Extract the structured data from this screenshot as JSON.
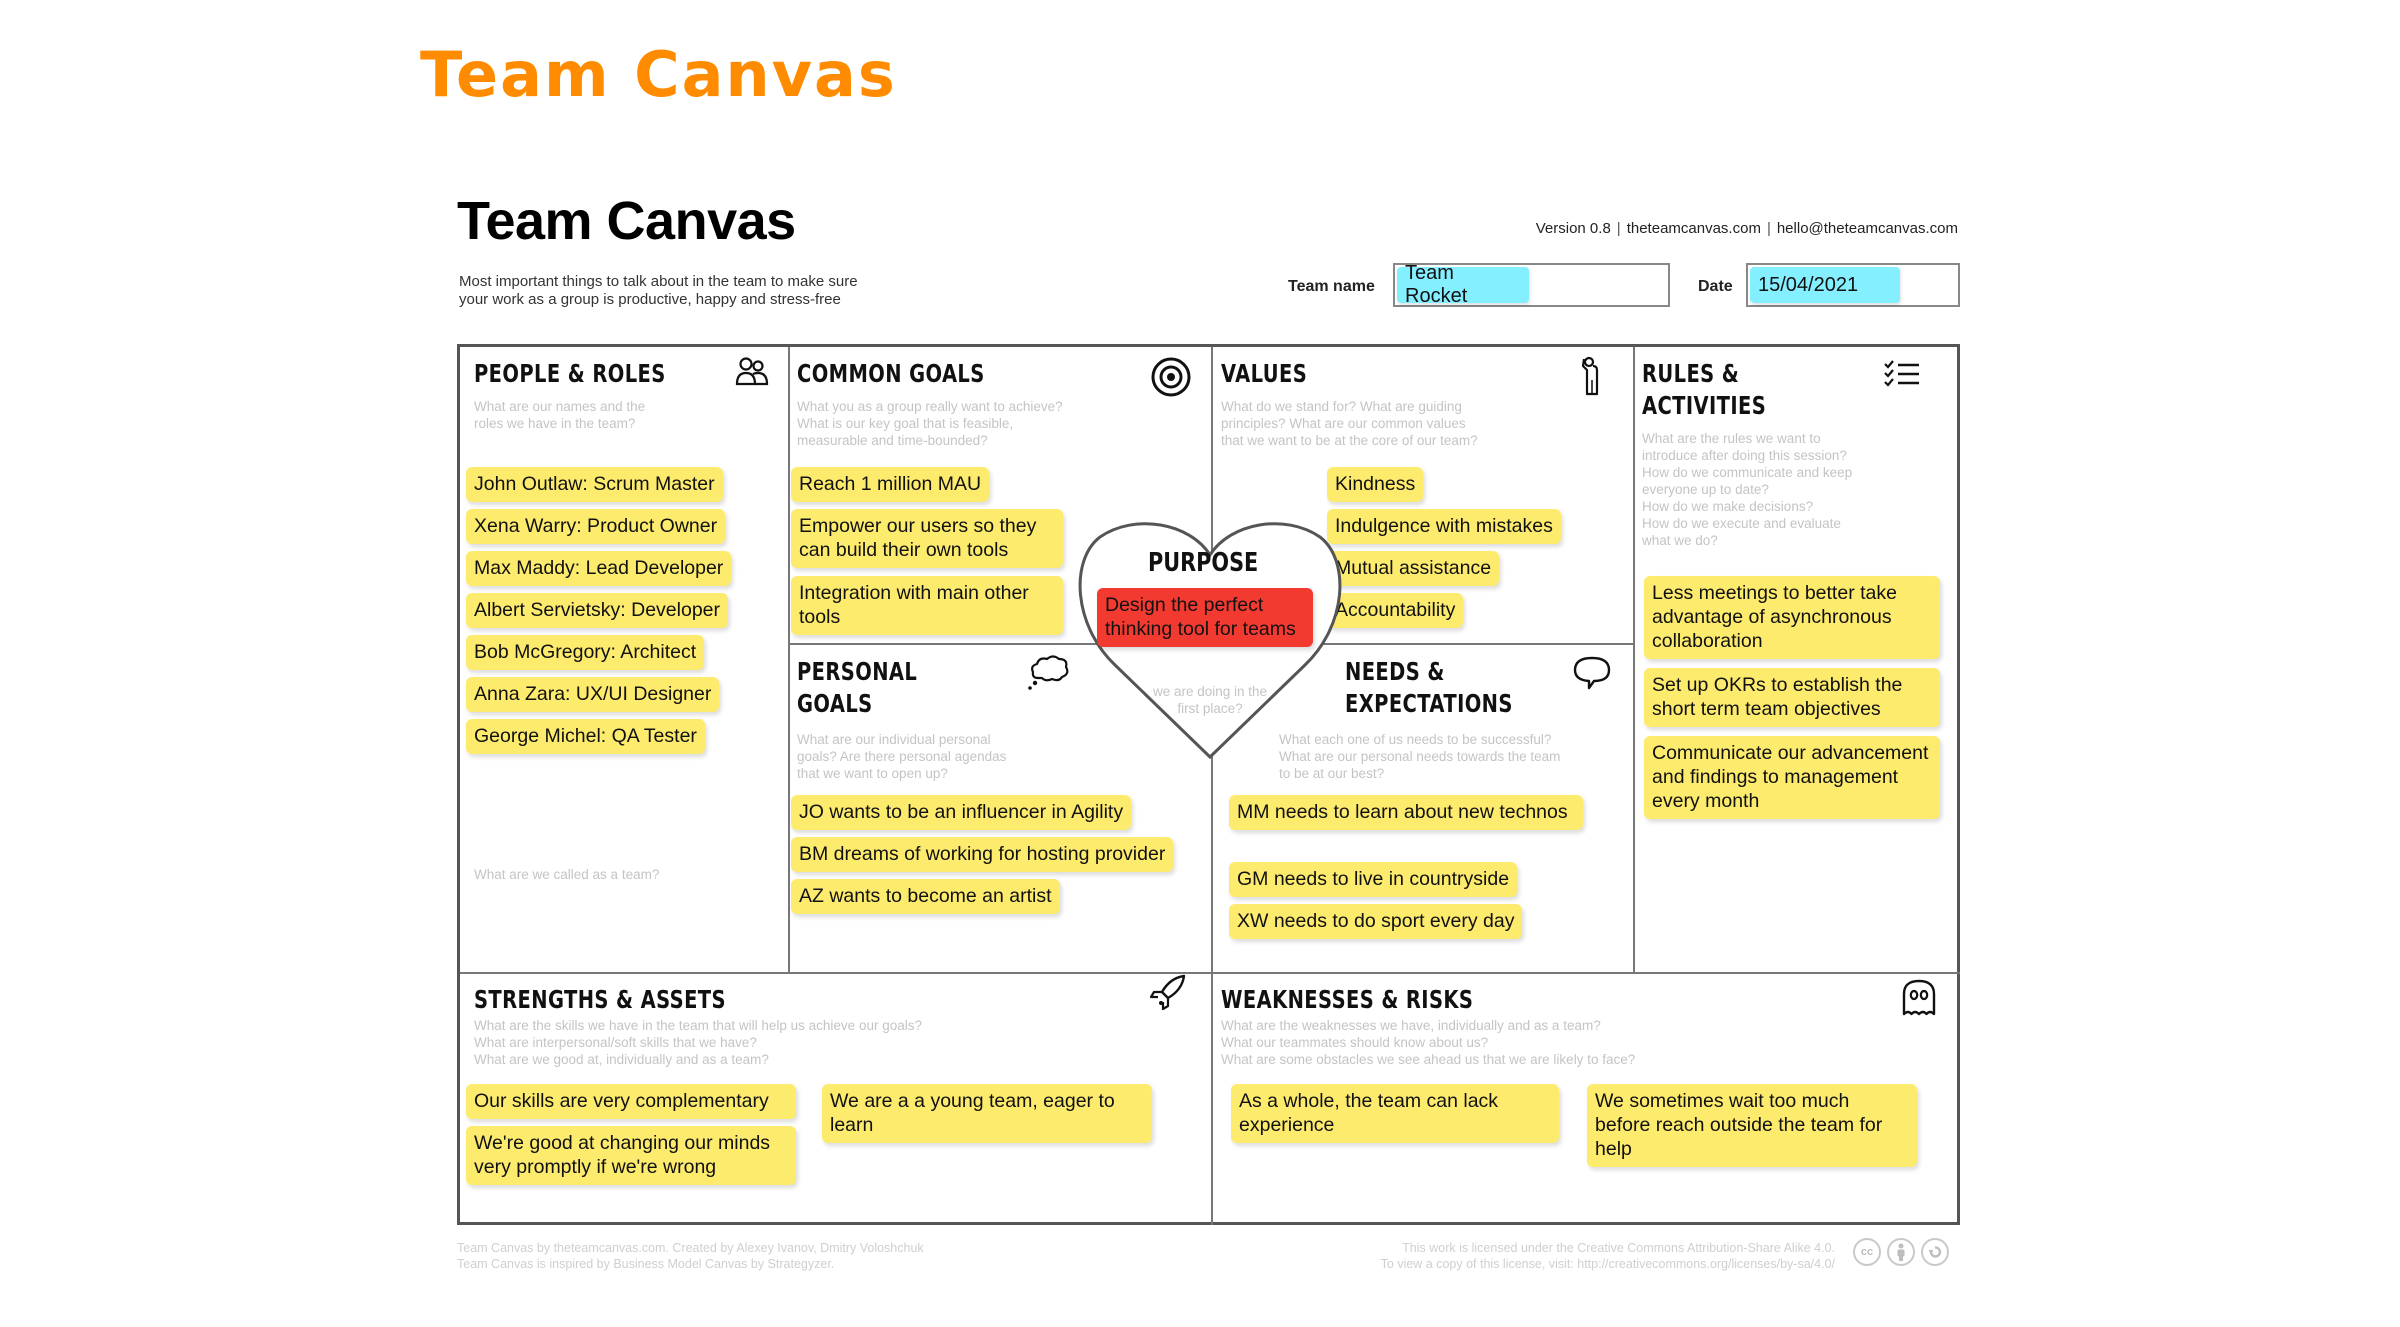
{
  "slide_title": "Team Canvas",
  "header": {
    "title": "Team Canvas",
    "subtitle_line1": "Most important things to talk about in the team to make sure",
    "subtitle_line2": "your work as a group is productive, happy and stress-free",
    "version": "Version 0.8",
    "website": "theteamcanvas.com",
    "email": "hello@theteamcanvas.com",
    "team_name_label": "Team name",
    "team_name_value": "Team Rocket",
    "date_label": "Date",
    "date_value": "15/04/2021"
  },
  "colors": {
    "slide_title": "#ff8c00",
    "sticky_yellow": "#fdeb6e",
    "sticky_red": "#f23a30",
    "field_chip": "#84efff"
  },
  "sections": {
    "people_roles": {
      "title": "PEOPLE & ROLES",
      "icon": "people-icon",
      "prompt_line1": "What are our names and the",
      "prompt_line2": "roles we have in the team?",
      "secondary_prompt": "What are we called as a team?",
      "notes": [
        "John Outlaw: Scrum Master",
        "Xena Warry: Product Owner",
        "Max Maddy: Lead Developer",
        "Albert Servietsky: Developer",
        "Bob McGregory: Architect",
        "Anna Zara: UX/UI Designer",
        "George Michel: QA Tester"
      ]
    },
    "common_goals": {
      "title": "COMMON GOALS",
      "icon": "target-icon",
      "prompt_line1": "What you as a group really want to achieve?",
      "prompt_line2": "What is our key goal that is feasible,",
      "prompt_line3": "measurable and time-bounded?",
      "notes": [
        "Reach 1 million MAU",
        "Empower our users so they can build their own tools",
        "Integration with main other tools"
      ]
    },
    "values": {
      "title": "VALUES",
      "icon": "standing-person-icon",
      "prompt_line1": "What do we stand for? What are guiding",
      "prompt_line2": "principles? What are our common values",
      "prompt_line3": "that we want to be at the core of our team?",
      "notes": [
        "Kindness",
        "Indulgence with mistakes",
        "Mutual assistance",
        "Accountability"
      ]
    },
    "rules_activities": {
      "title_line1": "RULES &",
      "title_line2": "ACTIVITIES",
      "icon": "checklist-icon",
      "prompt_lines": [
        "What are the rules we want to",
        "introduce after doing this session?",
        "How do we communicate and keep",
        "everyone up to date?",
        "How do we make decisions?",
        "How do we execute and evaluate",
        "what we do?"
      ],
      "notes": [
        "Less meetings to better take advantage of asynchronous collaboration",
        "Set up OKRs to establish the short term team objectives",
        "Communicate our advancement and findings to management every month"
      ]
    },
    "purpose": {
      "title": "PURPOSE",
      "icon": "heart-icon",
      "prompt_line1": "we are doing in the",
      "prompt_line2": "first place?",
      "note": "Design the perfect thinking tool for teams"
    },
    "personal_goals": {
      "title_line1": "PERSONAL",
      "title_line2": "GOALS",
      "icon": "thought-bubble-icon",
      "prompt_line1": "What are our individual personal",
      "prompt_line2": "goals? Are there personal agendas",
      "prompt_line3": "that we want to open up?",
      "notes": [
        "JO wants to be an influencer in Agility",
        "BM dreams of working for hosting provider",
        "AZ wants to become an artist"
      ]
    },
    "needs_expectations": {
      "title_line1": "NEEDS &",
      "title_line2": "EXPECTATIONS",
      "icon": "speech-bubble-icon",
      "prompt_line1": "What each one of us needs to be successful?",
      "prompt_line2": "What are our personal needs towards the team",
      "prompt_line3": "to be at our best?",
      "notes": [
        "MM needs to learn about new technos",
        "GM needs to live in countryside",
        "XW needs to do sport every day"
      ]
    },
    "strengths_assets": {
      "title": "STRENGTHS & ASSETS",
      "icon": "rocket-icon",
      "prompt_line1": "What are the skills we have in the team that will help us achieve our goals?",
      "prompt_line2": "What are interpersonal/soft skills that we have?",
      "prompt_line3": "What are we good at, individually and as a team?",
      "notes": [
        "Our skills are very complementary",
        "We're good at changing our minds very promptly if we're wrong",
        "We are a a young team, eager to learn"
      ]
    },
    "weaknesses_risks": {
      "title": "WEAKNESSES & RISKS",
      "icon": "ghost-icon",
      "prompt_line1": "What are the weaknesses we have, individually and as a team?",
      "prompt_line2": "What our teammates should know about us?",
      "prompt_line3": "What are some obstacles we see ahead us that we are likely to face?",
      "notes": [
        "As a whole, the team can lack experience",
        "We sometimes wait too much before reach outside the team for help"
      ]
    }
  },
  "footer": {
    "left_line1": "Team Canvas by theteamcanvas.com. Created by Alexey Ivanov, Dmitry Voloshchuk",
    "left_line2": "Team Canvas is inspired by Business Model Canvas by Strategyzer.",
    "right_line1": "This work is licensed under the Creative Commons Attribution-Share Alike 4.0.",
    "right_line2": "To view a copy of this license, visit: http://creativecommons.org/licenses/by-sa/4.0/",
    "license_icons": [
      "cc-icon",
      "attribution-icon",
      "share-alike-icon"
    ],
    "cc_label": "cc"
  }
}
